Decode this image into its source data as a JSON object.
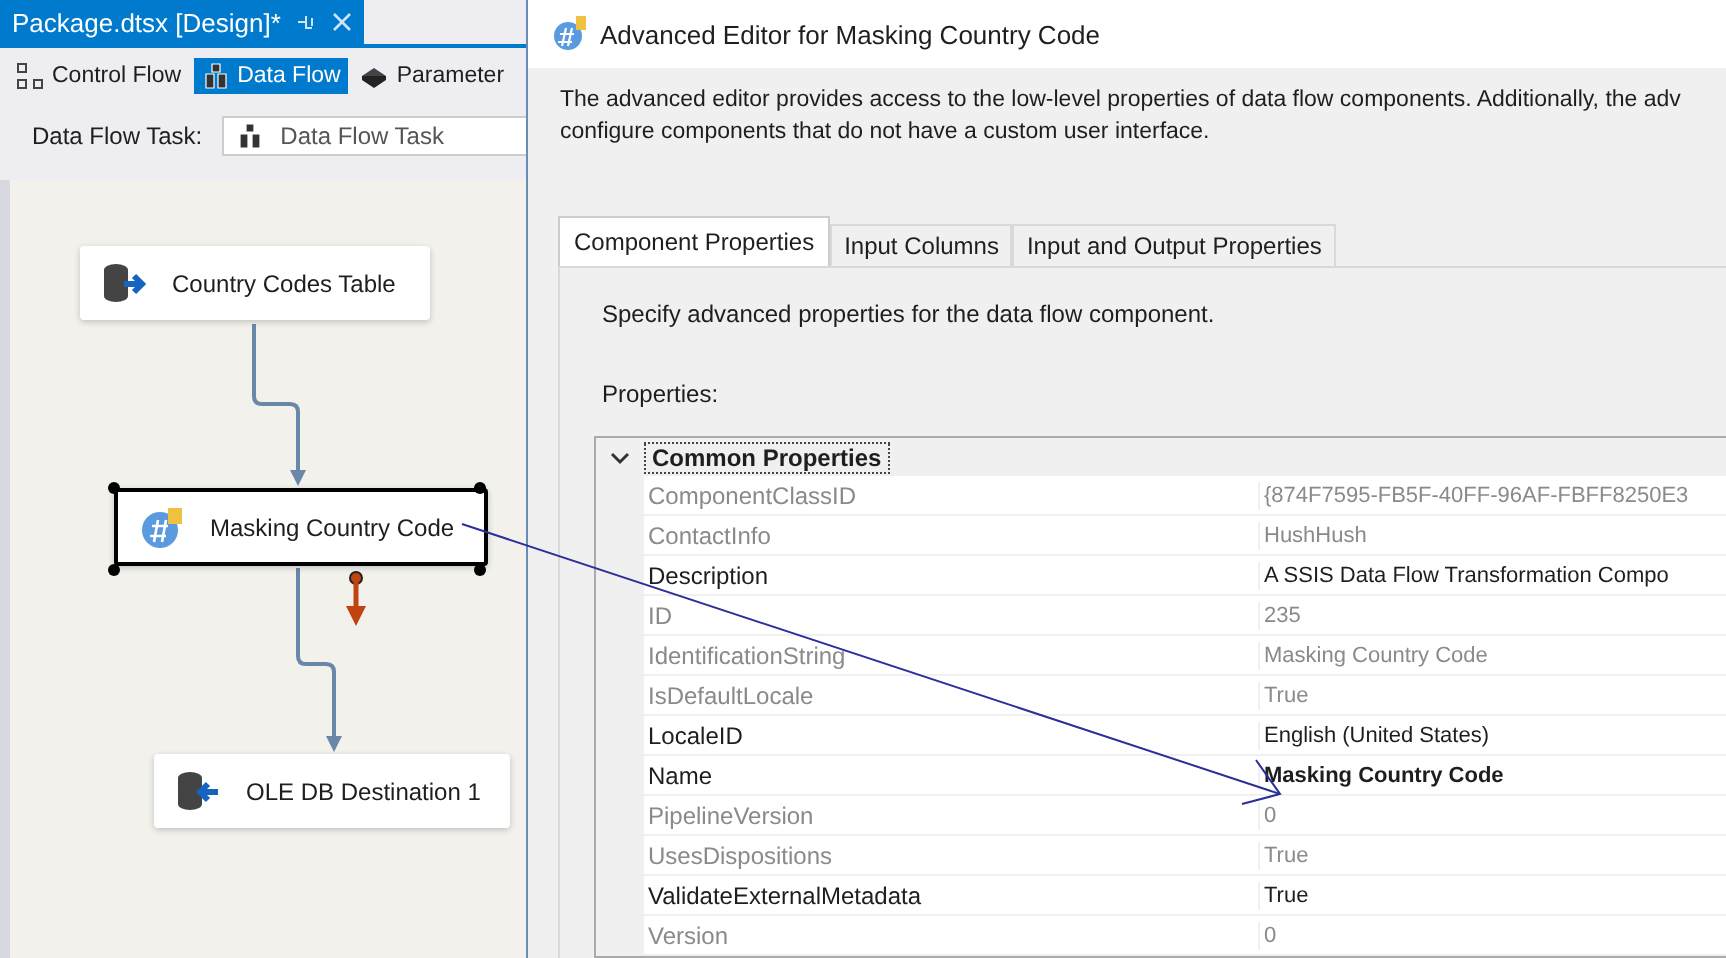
{
  "document_tab": {
    "title": "Package.dtsx [Design]*",
    "selected": true
  },
  "designer_tabs": [
    {
      "label": "Control Flow",
      "kind": "control",
      "selected": false
    },
    {
      "label": "Data Flow",
      "kind": "data",
      "selected": true
    },
    {
      "label": "Parameter",
      "kind": "parameters",
      "selected": false
    }
  ],
  "task_selector": {
    "label": "Data Flow Task:",
    "value": "Data Flow Task"
  },
  "canvas": {
    "nodes": [
      {
        "label": "Country Codes Table",
        "kind": "source",
        "selected": false
      },
      {
        "label": "Masking Country Code",
        "kind": "transform",
        "selected": true
      },
      {
        "label": "OLE DB Destination 1",
        "kind": "destination",
        "selected": false
      }
    ]
  },
  "dialog": {
    "title": "Advanced Editor for Masking Country Code",
    "intro_lines": [
      "The advanced editor provides access to the low-level properties of data flow components. Additionally, the adv",
      "configure components that do not have a custom user interface."
    ],
    "tabs": [
      {
        "label": "Component Properties",
        "selected": true
      },
      {
        "label": "Input Columns",
        "selected": false
      },
      {
        "label": "Input and Output Properties",
        "selected": false
      }
    ],
    "instructions": "Specify advanced properties for the data flow component.",
    "properties_label": "Properties:",
    "grid": {
      "category": {
        "label": "Common Properties",
        "expanded": true
      },
      "rows": [
        {
          "name": "ComponentClassID",
          "value": "{874F7595-FB5F-40FF-96AF-FBFF8250E3",
          "disabled": true,
          "modified": false
        },
        {
          "name": "ContactInfo",
          "value": "HushHush",
          "disabled": true,
          "modified": false
        },
        {
          "name": "Description",
          "value": "A SSIS Data Flow Transformation Compo",
          "disabled": false,
          "modified": false
        },
        {
          "name": "ID",
          "value": "235",
          "disabled": true,
          "modified": false
        },
        {
          "name": "IdentificationString",
          "value": "Masking Country Code",
          "disabled": true,
          "modified": false
        },
        {
          "name": "IsDefaultLocale",
          "value": "True",
          "disabled": true,
          "modified": false
        },
        {
          "name": "LocaleID",
          "value": "English (United States)",
          "disabled": false,
          "modified": false
        },
        {
          "name": "Name",
          "value": "Masking Country Code",
          "disabled": false,
          "modified": true
        },
        {
          "name": "PipelineVersion",
          "value": "0",
          "disabled": true,
          "modified": false
        },
        {
          "name": "UsesDispositions",
          "value": "True",
          "disabled": true,
          "modified": false
        },
        {
          "name": "ValidateExternalMetadata",
          "value": "True",
          "disabled": false,
          "modified": false
        },
        {
          "name": "Version",
          "value": "0",
          "disabled": true,
          "modified": false
        }
      ]
    }
  }
}
